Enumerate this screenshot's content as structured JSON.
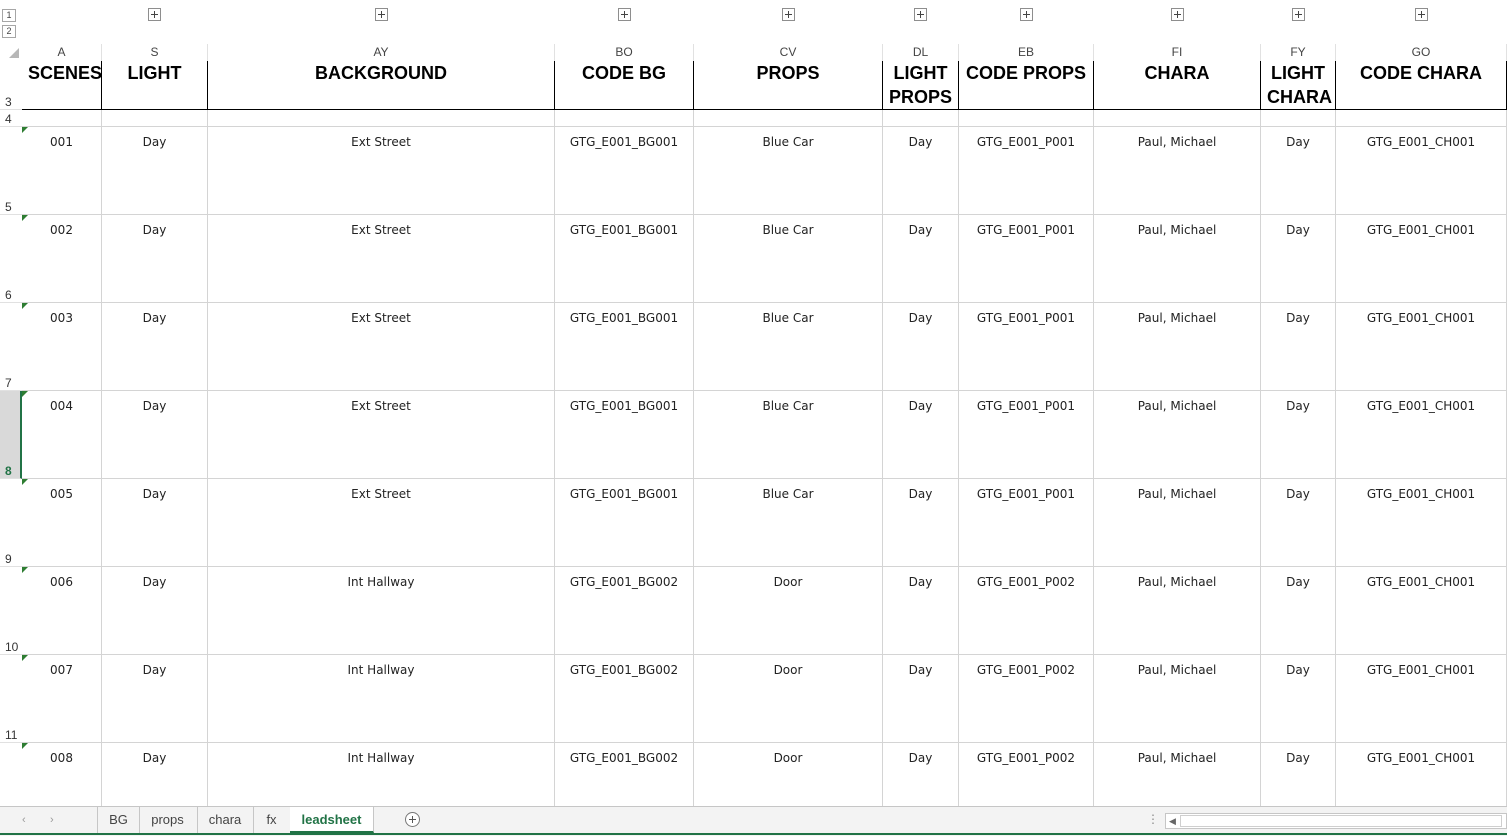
{
  "outline": {
    "levels": [
      "1",
      "2"
    ]
  },
  "columns": [
    {
      "letter": "A"
    },
    {
      "letter": "S"
    },
    {
      "letter": "AY"
    },
    {
      "letter": "BO"
    },
    {
      "letter": "CV"
    },
    {
      "letter": "DL"
    },
    {
      "letter": "EB"
    },
    {
      "letter": "FI"
    },
    {
      "letter": "FY"
    },
    {
      "letter": "GO"
    }
  ],
  "header_row": {
    "row_number": "3",
    "cells": [
      "SCENES",
      "LIGHT",
      "BACKGROUND",
      "CODE BG",
      "PROPS",
      "LIGHT PROPS",
      "CODE PROPS",
      "CHARA",
      "LIGHT CHARA",
      "CODE CHARA"
    ]
  },
  "blank_row": {
    "row_number": "4"
  },
  "rows": [
    {
      "row_number": "5",
      "cells": [
        "001",
        "Day",
        "Ext Street",
        "GTG_E001_BG001",
        "Blue Car",
        "Day",
        "GTG_E001_P001",
        "Paul, Michael",
        "Day",
        "GTG_E001_CH001"
      ]
    },
    {
      "row_number": "6",
      "cells": [
        "002",
        "Day",
        "Ext Street",
        "GTG_E001_BG001",
        "Blue Car",
        "Day",
        "GTG_E001_P001",
        "Paul, Michael",
        "Day",
        "GTG_E001_CH001"
      ]
    },
    {
      "row_number": "7",
      "cells": [
        "003",
        "Day",
        "Ext Street",
        "GTG_E001_BG001",
        "Blue Car",
        "Day",
        "GTG_E001_P001",
        "Paul, Michael",
        "Day",
        "GTG_E001_CH001"
      ]
    },
    {
      "row_number": "8",
      "cells": [
        "004",
        "Day",
        "Ext Street",
        "GTG_E001_BG001",
        "Blue Car",
        "Day",
        "GTG_E001_P001",
        "Paul, Michael",
        "Day",
        "GTG_E001_CH001"
      ]
    },
    {
      "row_number": "9",
      "cells": [
        "005",
        "Day",
        "Ext Street",
        "GTG_E001_BG001",
        "Blue Car",
        "Day",
        "GTG_E001_P001",
        "Paul, Michael",
        "Day",
        "GTG_E001_CH001"
      ]
    },
    {
      "row_number": "10",
      "cells": [
        "006",
        "Day",
        "Int Hallway",
        "GTG_E001_BG002",
        "Door",
        "Day",
        "GTG_E001_P002",
        "Paul, Michael",
        "Day",
        "GTG_E001_CH001"
      ]
    },
    {
      "row_number": "11",
      "cells": [
        "007",
        "Day",
        "Int Hallway",
        "GTG_E001_BG002",
        "Door",
        "Day",
        "GTG_E001_P002",
        "Paul, Michael",
        "Day",
        "GTG_E001_CH001"
      ]
    },
    {
      "row_number": "",
      "cells": [
        "008",
        "Day",
        "Int Hallway",
        "GTG_E001_BG002",
        "Door",
        "Day",
        "GTG_E001_P002",
        "Paul, Michael",
        "Day",
        "GTG_E001_CH001"
      ]
    }
  ],
  "selected_row": "8",
  "sheet_tabs": [
    {
      "label": "BG",
      "active": false
    },
    {
      "label": "props",
      "active": false
    },
    {
      "label": "chara",
      "active": false
    },
    {
      "label": "fx",
      "active": false
    },
    {
      "label": "leadsheet",
      "active": true
    }
  ],
  "navigation": {
    "prev_icon": "‹",
    "next_icon": "›"
  },
  "colors": {
    "accent": "#217346",
    "comment_marker": "#2e7d32",
    "gridline": "#d4d4d4"
  }
}
